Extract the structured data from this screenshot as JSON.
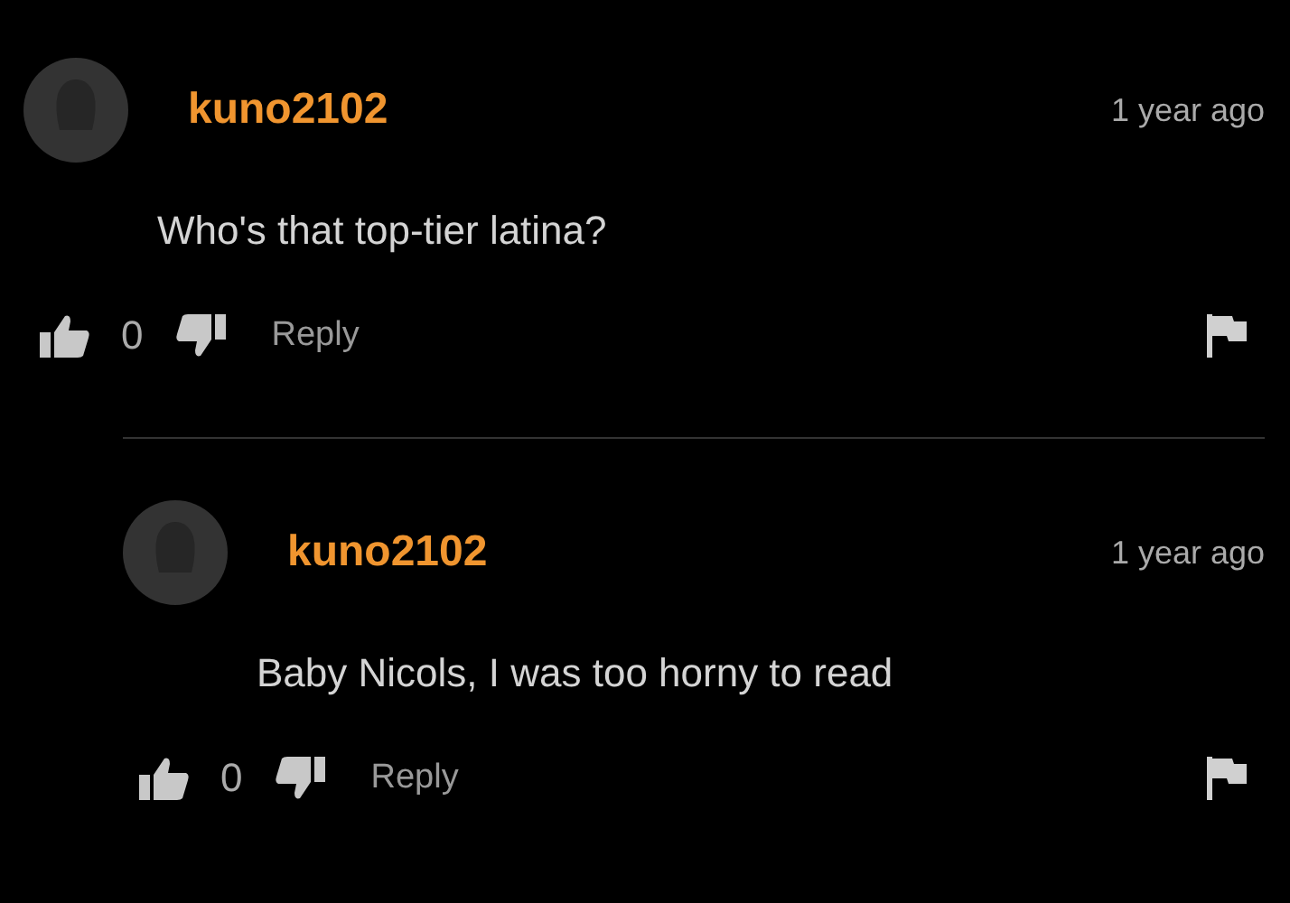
{
  "comments": [
    {
      "author": "kuno2102",
      "time": "1 year ago",
      "text": "Who's that top-tier latina?",
      "likes": "0",
      "reply": "Reply",
      "children": [
        {
          "author": "kuno2102",
          "time": "1 year ago",
          "text": "Baby Nicols, I was too horny to read",
          "likes": "0",
          "reply": "Reply"
        }
      ]
    }
  ]
}
